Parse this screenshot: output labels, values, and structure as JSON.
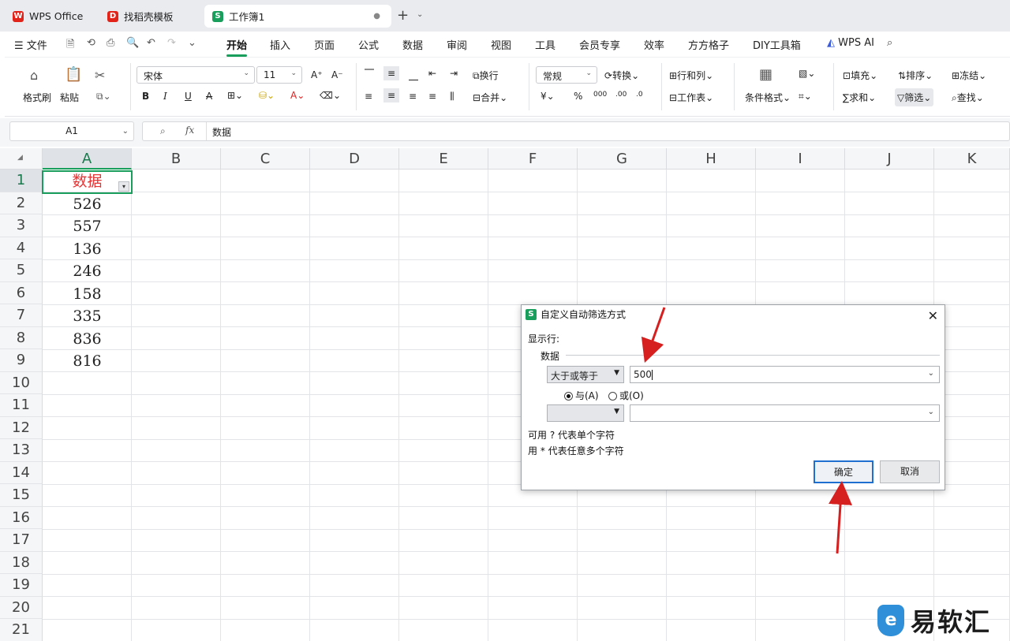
{
  "tabs": [
    {
      "label": "WPS Office",
      "icon": "wps-logo-icon",
      "color": "#e2231a"
    },
    {
      "label": "找稻壳模板",
      "icon": "docer-logo-icon",
      "color": "#e2231a"
    },
    {
      "label": "工作簿1",
      "icon": "sheet-logo-icon",
      "color": "#1a9e5c",
      "active": true
    }
  ],
  "menu": {
    "file": "文件",
    "items": [
      "开始",
      "插入",
      "页面",
      "公式",
      "数据",
      "审阅",
      "视图",
      "工具",
      "会员专享",
      "效率",
      "方方格子",
      "DIY工具箱"
    ],
    "active": "开始",
    "wps_ai": "WPS AI"
  },
  "ribbon": {
    "format_painter": "格式刷",
    "paste": "粘贴",
    "font_name": "宋体",
    "font_size": "11",
    "wrap": "换行",
    "merge": "合并",
    "number_format": "常规",
    "convert": "转换",
    "rows_cols": "行和列",
    "worksheet": "工作表",
    "cond_format": "条件格式",
    "fill": "填充",
    "sort": "排序",
    "freeze": "冻结",
    "sum": "求和",
    "filter": "筛选",
    "find": "查找",
    "bold": "B",
    "italic": "I",
    "underline": "U",
    "strike": "A",
    "currency": "¥",
    "percent": "%"
  },
  "formula_bar": {
    "name_box": "A1",
    "fx": "fx",
    "value": "数据"
  },
  "sheet": {
    "columns": [
      "A",
      "B",
      "C",
      "D",
      "E",
      "F",
      "G",
      "H",
      "I",
      "J",
      "K"
    ],
    "rows": [
      "1",
      "2",
      "3",
      "4",
      "5",
      "6",
      "7",
      "8",
      "9",
      "10",
      "11",
      "12",
      "13",
      "14",
      "15",
      "16",
      "17",
      "18",
      "19",
      "20",
      "21"
    ],
    "col_a": [
      "数据",
      "526",
      "557",
      "136",
      "246",
      "158",
      "335",
      "836",
      "816"
    ]
  },
  "dialog": {
    "title": "自定义自动筛选方式",
    "show_rows": "显示行:",
    "group_label": "数据",
    "op1": "大于或等于",
    "val1": "500",
    "and_label": "与(A)",
    "or_label": "或(O)",
    "op2": "",
    "val2": "",
    "hint1": "可用 ? 代表单个字符",
    "hint2": "用 * 代表任意多个字符",
    "ok": "确定",
    "cancel": "取消",
    "close": "✕"
  },
  "watermark": "易软汇",
  "colors": {
    "accent": "#1a9e5c",
    "arrow": "#d62020",
    "header_text": "#e53535"
  }
}
